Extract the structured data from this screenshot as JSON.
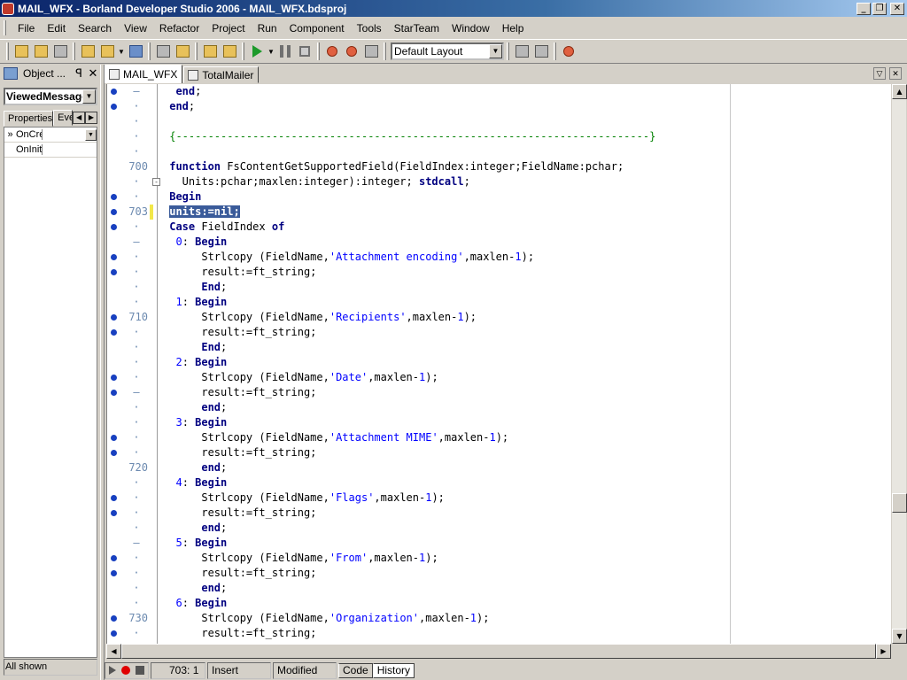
{
  "window": {
    "title": "MAIL_WFX - Borland Developer Studio 2006 - MAIL_WFX.bdsproj",
    "minimize": "_",
    "restore": "❐",
    "close": "✕"
  },
  "menu": [
    "File",
    "Edit",
    "Search",
    "View",
    "Refactor",
    "Project",
    "Run",
    "Component",
    "Tools",
    "StarTeam",
    "Window",
    "Help"
  ],
  "toolbar": {
    "layout_value": "Default Layout",
    "dropdown_glyph": "▼"
  },
  "object_inspector": {
    "title": "Object ...",
    "pin": "ꟼ",
    "close": "✕",
    "component": "ViewedMessage",
    "tabs": [
      "Properties",
      "Events"
    ],
    "events": [
      {
        "arrow": "»",
        "name": "OnCre"
      },
      {
        "arrow": "",
        "name": "OnInit"
      }
    ],
    "status": "All shown"
  },
  "editor": {
    "tabs": [
      "MAIL_WFX",
      "TotalMailer"
    ],
    "right_buttons": [
      "▽",
      "✕"
    ],
    "lines": [
      {
        "bp": true,
        "mark": "–",
        "html": "  <span class='kw'>end</span>;"
      },
      {
        "bp": true,
        "mark": "·",
        "html": " <span class='kw'>end</span>;"
      },
      {
        "bp": false,
        "mark": "·",
        "html": ""
      },
      {
        "bp": false,
        "mark": "·",
        "html": " <span class='cmt'>{--------------------------------------------------------------------------}</span>"
      },
      {
        "bp": false,
        "mark": "·",
        "html": ""
      },
      {
        "bp": false,
        "ln": "700",
        "html": " <span class='kw'>function</span> FsContentGetSupportedField(FieldIndex:integer;FieldName:pchar;"
      },
      {
        "bp": false,
        "mark": "·",
        "fold": "⊟",
        "html": "   Units:pchar;maxlen:integer):integer; <span class='kw'>stdcall</span>;"
      },
      {
        "bp": true,
        "mark": "·",
        "html": " <span class='kw'>Begin</span>"
      },
      {
        "bp": true,
        "ln": "703",
        "mod": true,
        "html": " <span class='sel'>units:=nil;</span>"
      },
      {
        "bp": true,
        "mark": "·",
        "html": " <span class='kw'>Case</span> FieldIndex <span class='kw'>of</span>"
      },
      {
        "bp": false,
        "mark": "–",
        "html": "  <span class='num'>0</span>: <span class='kw'>Begin</span>"
      },
      {
        "bp": true,
        "mark": "·",
        "html": "      Strlcopy (FieldName,<span class='str'>'Attachment encoding'</span>,maxlen-<span class='num'>1</span>);"
      },
      {
        "bp": true,
        "mark": "·",
        "html": "      result:=ft_string;"
      },
      {
        "bp": false,
        "mark": "·",
        "html": "      <span class='kw'>End</span>;"
      },
      {
        "bp": false,
        "mark": "·",
        "html": "  <span class='num'>1</span>: <span class='kw'>Begin</span>"
      },
      {
        "bp": true,
        "ln": "710",
        "html": "      Strlcopy (FieldName,<span class='str'>'Recipients'</span>,maxlen-<span class='num'>1</span>);"
      },
      {
        "bp": true,
        "mark": "·",
        "html": "      result:=ft_string;"
      },
      {
        "bp": false,
        "mark": "·",
        "html": "      <span class='kw'>End</span>;"
      },
      {
        "bp": false,
        "mark": "·",
        "html": "  <span class='num'>2</span>: <span class='kw'>Begin</span>"
      },
      {
        "bp": true,
        "mark": "·",
        "html": "      Strlcopy (FieldName,<span class='str'>'Date'</span>,maxlen-<span class='num'>1</span>);"
      },
      {
        "bp": true,
        "mark": "–",
        "html": "      result:=ft_string;"
      },
      {
        "bp": false,
        "mark": "·",
        "html": "      <span class='kw'>end</span>;"
      },
      {
        "bp": false,
        "mark": "·",
        "html": "  <span class='num'>3</span>: <span class='kw'>Begin</span>"
      },
      {
        "bp": true,
        "mark": "·",
        "html": "      Strlcopy (FieldName,<span class='str'>'Attachment MIME'</span>,maxlen-<span class='num'>1</span>);"
      },
      {
        "bp": true,
        "mark": "·",
        "html": "      result:=ft_string;"
      },
      {
        "bp": false,
        "ln": "720",
        "html": "      <span class='kw'>end</span>;"
      },
      {
        "bp": false,
        "mark": "·",
        "html": "  <span class='num'>4</span>: <span class='kw'>Begin</span>"
      },
      {
        "bp": true,
        "mark": "·",
        "html": "      Strlcopy (FieldName,<span class='str'>'Flags'</span>,maxlen-<span class='num'>1</span>);"
      },
      {
        "bp": true,
        "mark": "·",
        "html": "      result:=ft_string;"
      },
      {
        "bp": false,
        "mark": "·",
        "html": "      <span class='kw'>end</span>;"
      },
      {
        "bp": false,
        "mark": "–",
        "html": "  <span class='num'>5</span>: <span class='kw'>Begin</span>"
      },
      {
        "bp": true,
        "mark": "·",
        "html": "      Strlcopy (FieldName,<span class='str'>'From'</span>,maxlen-<span class='num'>1</span>);"
      },
      {
        "bp": true,
        "mark": "·",
        "html": "      result:=ft_string;"
      },
      {
        "bp": false,
        "mark": "·",
        "html": "      <span class='kw'>end</span>;"
      },
      {
        "bp": false,
        "mark": "·",
        "html": "  <span class='num'>6</span>: <span class='kw'>Begin</span>"
      },
      {
        "bp": true,
        "ln": "730",
        "html": "      Strlcopy (FieldName,<span class='str'>'Organization'</span>,maxlen-<span class='num'>1</span>);"
      },
      {
        "bp": true,
        "mark": "·",
        "html": "      result:=ft_string;"
      }
    ]
  },
  "statusbar": {
    "position": "703:  1",
    "mode": "Insert",
    "state": "Modified",
    "tabs": [
      "Code",
      "History"
    ]
  },
  "colors": {
    "keyword": "#000080",
    "string": "#0000ff",
    "comment": "#008000",
    "selection": "#3a5b9a",
    "breakpoint": "#1840c0"
  }
}
